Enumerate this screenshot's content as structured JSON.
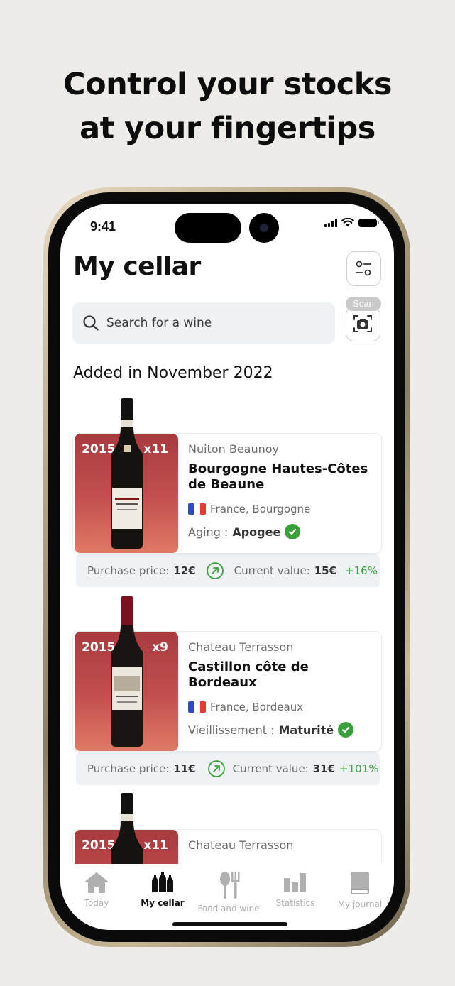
{
  "headline": {
    "line1": "Control your stocks",
    "line2": "at your fingertips"
  },
  "status_bar": {
    "time": "9:41"
  },
  "screen": {
    "title": "My cellar",
    "search": {
      "placeholder": "Search for a wine"
    },
    "scan_label": "Scan",
    "section_heading": "Added in November 2022"
  },
  "wines": [
    {
      "vintage": "2015",
      "quantity": "x11",
      "producer": "Nuiton Beaunoy",
      "name": "Bourgogne Hautes-Côtes de Beaune",
      "origin": "France, Bourgogne",
      "aging_label": "Aging :",
      "aging_value": "Apogee",
      "purchase_label": "Purchase price:",
      "purchase_value": "12€",
      "current_label": "Current value:",
      "current_value": "15€",
      "gain": "+16%"
    },
    {
      "vintage": "2015",
      "quantity": "x9",
      "producer": "Chateau Terrasson",
      "name": "Castillon côte de Bordeaux",
      "origin": "France, Bordeaux",
      "aging_label": "Vieillissement :",
      "aging_value": "Maturité",
      "purchase_label": "Purchase price:",
      "purchase_value": "11€",
      "current_label": "Current value:",
      "current_value": "31€",
      "gain": "+101%"
    },
    {
      "vintage": "2015",
      "quantity": "x11",
      "producer": "Chateau Terrasson"
    }
  ],
  "tabs": [
    {
      "label": "Today",
      "icon": "home-icon"
    },
    {
      "label": "My cellar",
      "icon": "bottles-icon"
    },
    {
      "label": "Food and wine",
      "icon": "fork-knife-icon"
    },
    {
      "label": "Statistics",
      "icon": "bar-chart-icon"
    },
    {
      "label": "My journal",
      "icon": "book-icon"
    }
  ],
  "colors": {
    "background": "#edece8",
    "wine_tile": "#c45050",
    "gain_green": "#3aa13a",
    "search_bg": "#eef2f5"
  }
}
